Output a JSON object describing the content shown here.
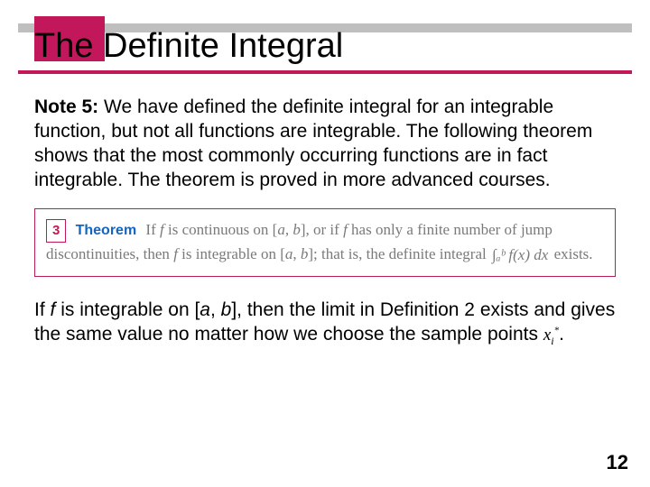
{
  "title": "The Definite Integral",
  "note_label": "Note 5:",
  "note_body": " We have defined the definite integral for an integrable function, but not all functions are integrable. The following theorem shows that the most commonly occurring functions are in fact integrable. The theorem is proved in more advanced courses.",
  "theorem": {
    "number": "3",
    "label": "Theorem",
    "pre_f1": "If ",
    "f1": "f",
    "mid1": " is continuous on [",
    "a1": "a",
    "comma1": ", ",
    "b1": "b",
    "mid2": "], or if ",
    "f2": "f",
    "mid3": " has only a finite number of jump discontinuities, then ",
    "f3": "f",
    "mid4": " is integrable on [",
    "a2": "a",
    "comma2": ", ",
    "b2": "b",
    "mid5": "]; that is, the definite integral ",
    "integral_expr": "∫ₐᵇ f(x) dx",
    "tail": " exists."
  },
  "closing": {
    "pre": "If ",
    "f": "f",
    "mid1": " is integrable on [",
    "a": "a",
    "comma": ", ",
    "b": "b",
    "mid2": "], then the limit in Definition 2 exists and gives the same value no matter how we choose the sample points ",
    "xstar_base": "x",
    "xstar_sub": "i",
    "xstar_sup": "*",
    "period": "."
  },
  "page_number": "12"
}
